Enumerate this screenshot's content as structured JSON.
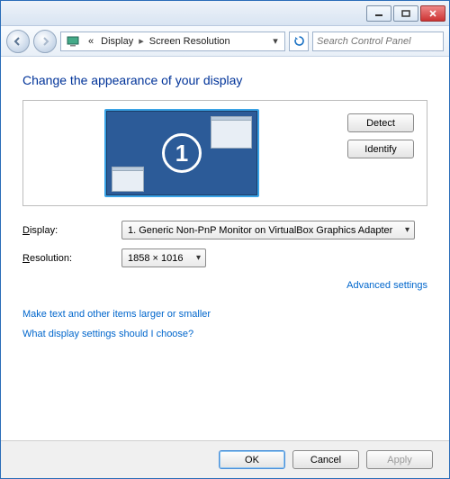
{
  "titlebar": {
    "min": "min",
    "max": "max",
    "close": "close"
  },
  "nav": {
    "back": "back",
    "forward": "forward",
    "crumb_prefix": "«",
    "crumb1": "Display",
    "crumb2": "Screen Resolution",
    "search_placeholder": "Search Control Panel"
  },
  "page": {
    "heading": "Change the appearance of your display",
    "monitor_number": "1",
    "detect": "Detect",
    "identify": "Identify",
    "display_label_pre": "D",
    "display_label_post": "isplay:",
    "resolution_label_pre": "R",
    "resolution_label_post": "esolution:",
    "display_value": "1. Generic Non-PnP Monitor on VirtualBox Graphics Adapter",
    "resolution_value": "1858 × 1016",
    "advanced": "Advanced settings",
    "link_textsize": "Make text and other items larger or smaller",
    "link_help": "What display settings should I choose?"
  },
  "footer": {
    "ok": "OK",
    "cancel": "Cancel",
    "apply": "Apply"
  }
}
